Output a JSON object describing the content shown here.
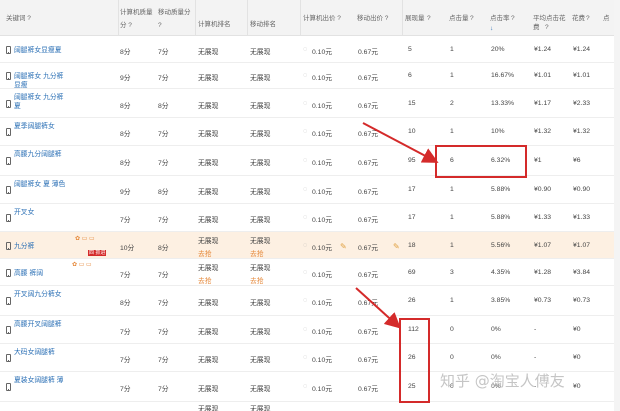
{
  "headers": {
    "keyword": "关键词 ?",
    "pc_quality": "计算机质量",
    "pc_quality_q": "分 ?",
    "mobile_quality": "移动质量分",
    "mobile_quality_q": "?",
    "pc_rank": "计算机排名",
    "mobile_rank": "移动排名",
    "pc_bid": "计算机出价 ?",
    "mobile_bid": "移动出价 ?",
    "impressions": "展现量",
    "impressions_q": "?",
    "clicks": "点击量",
    "clicks_q": "?",
    "ctr": "点击率",
    "ctr_q": "?",
    "ctr_sort": "↓",
    "avg_cpc": "平均点击花",
    "avg_cpc2": "费",
    "avg_cpc_q": "?",
    "cost": "花费",
    "cost_q": "?",
    "more": "点"
  },
  "rows": [
    {
      "kw": "阔腿裤女显瘦夏",
      "pcq": "8分",
      "mq": "7分",
      "pcr": "无展现",
      "mr": "无展现",
      "pcb": "0.10元",
      "mb": "0.67元",
      "imp": "5",
      "clk": "1",
      "ctr": "20%",
      "cpc": "¥1.24",
      "cost": "¥1.24"
    },
    {
      "kw": "阔腿裤女 九分裤 显瘦",
      "pcq": "9分",
      "mq": "7分",
      "pcr": "无展现",
      "mr": "无展现",
      "pcb": "0.10元",
      "mb": "0.67元",
      "imp": "6",
      "clk": "1",
      "ctr": "16.67%",
      "cpc": "¥1.01",
      "cost": "¥1.01"
    },
    {
      "kw": "阔腿裤女 九分裤 夏",
      "pcq": "8分",
      "mq": "8分",
      "pcr": "无展现",
      "mr": "无展现",
      "pcb": "0.10元",
      "mb": "0.67元",
      "imp": "15",
      "clk": "2",
      "ctr": "13.33%",
      "cpc": "¥1.17",
      "cost": "¥2.33"
    },
    {
      "kw": "夏季阔腿裤女",
      "pcq": "8分",
      "mq": "7分",
      "pcr": "无展现",
      "mr": "无展现",
      "pcb": "0.10元",
      "mb": "0.67元",
      "imp": "10",
      "clk": "1",
      "ctr": "10%",
      "cpc": "¥1.32",
      "cost": "¥1.32"
    },
    {
      "kw": "高腰九分阔腿裤",
      "pcq": "8分",
      "mq": "7分",
      "pcr": "无展现",
      "mr": "无展现",
      "pcb": "0.10元",
      "mb": "0.67元",
      "imp": "95",
      "clk": "6",
      "ctr": "6.32%",
      "cpc": "¥1",
      "cost": "¥6"
    },
    {
      "kw": "阔腿裤女 夏 薄色",
      "pcq": "9分",
      "mq": "8分",
      "pcr": "无展现",
      "mr": "无展现",
      "pcb": "0.10元",
      "mb": "0.67元",
      "imp": "17",
      "clk": "1",
      "ctr": "5.88%",
      "cpc": "¥0.90",
      "cost": "¥0.90"
    },
    {
      "kw": "开叉女",
      "pcq": "7分",
      "mq": "7分",
      "pcr": "无展现",
      "mr": "无展现",
      "pcb": "0.10元",
      "mb": "0.67元",
      "imp": "17",
      "clk": "1",
      "ctr": "5.88%",
      "cpc": "¥1.33",
      "cost": "¥1.33"
    },
    {
      "kw": "九分裤",
      "pcq": "10分",
      "mq": "8分",
      "pcr": "无展现",
      "mr": "无展现",
      "pcb": "0.10元",
      "mb": "0.67元",
      "imp": "18",
      "clk": "1",
      "ctr": "5.56%",
      "cpc": "¥1.07",
      "cost": "¥1.07",
      "pcr_note": "去抢",
      "mr_note": "去抢"
    },
    {
      "kw": "高腰 裤阔",
      "pcq": "7分",
      "mq": "7分",
      "pcr": "无展现",
      "mr": "无展现",
      "pcb": "0.10元",
      "mb": "0.67元",
      "imp": "69",
      "clk": "3",
      "ctr": "4.35%",
      "cpc": "¥1.28",
      "cost": "¥3.84",
      "pcr_note": "去抢",
      "mr_note": "去抢"
    },
    {
      "kw": "开叉阔九分裤女",
      "pcq": "8分",
      "mq": "7分",
      "pcr": "无展现",
      "mr": "无展现",
      "pcb": "0.10元",
      "mb": "0.67元",
      "imp": "26",
      "clk": "1",
      "ctr": "3.85%",
      "cpc": "¥0.73",
      "cost": "¥0.73"
    },
    {
      "kw": "高腰开叉阔腿裤",
      "pcq": "7分",
      "mq": "7分",
      "pcr": "无展现",
      "mr": "无展现",
      "pcb": "0.10元",
      "mb": "0.67元",
      "imp": "112",
      "clk": "0",
      "ctr": "0%",
      "cpc": "-",
      "cost": "¥0"
    },
    {
      "kw": "大码女阔腿裤",
      "pcq": "7分",
      "mq": "7分",
      "pcr": "无展现",
      "mr": "无展现",
      "pcb": "0.10元",
      "mb": "0.67元",
      "imp": "26",
      "clk": "0",
      "ctr": "0%",
      "cpc": "-",
      "cost": "¥0"
    },
    {
      "kw": "夏装女阔腿裤 薄",
      "pcq": "7分",
      "mq": "7分",
      "pcr": "无展现",
      "mr": "无展现",
      "pcb": "0.10元",
      "mb": "0.67元",
      "imp": "25",
      "clk": "0",
      "ctr": "0%",
      "cpc": "-",
      "cost": "¥0"
    }
  ],
  "last_row": {
    "pcr": "无展现",
    "mr": "无展现"
  },
  "row9_tags": {
    "tag": "四 抓进"
  },
  "watermark": "知乎 @淘宝人傅友",
  "colors": {
    "highlight_row": "#fdf0e2",
    "red_box": "#d42a2a",
    "keyword_link": "#2a6fb5"
  }
}
